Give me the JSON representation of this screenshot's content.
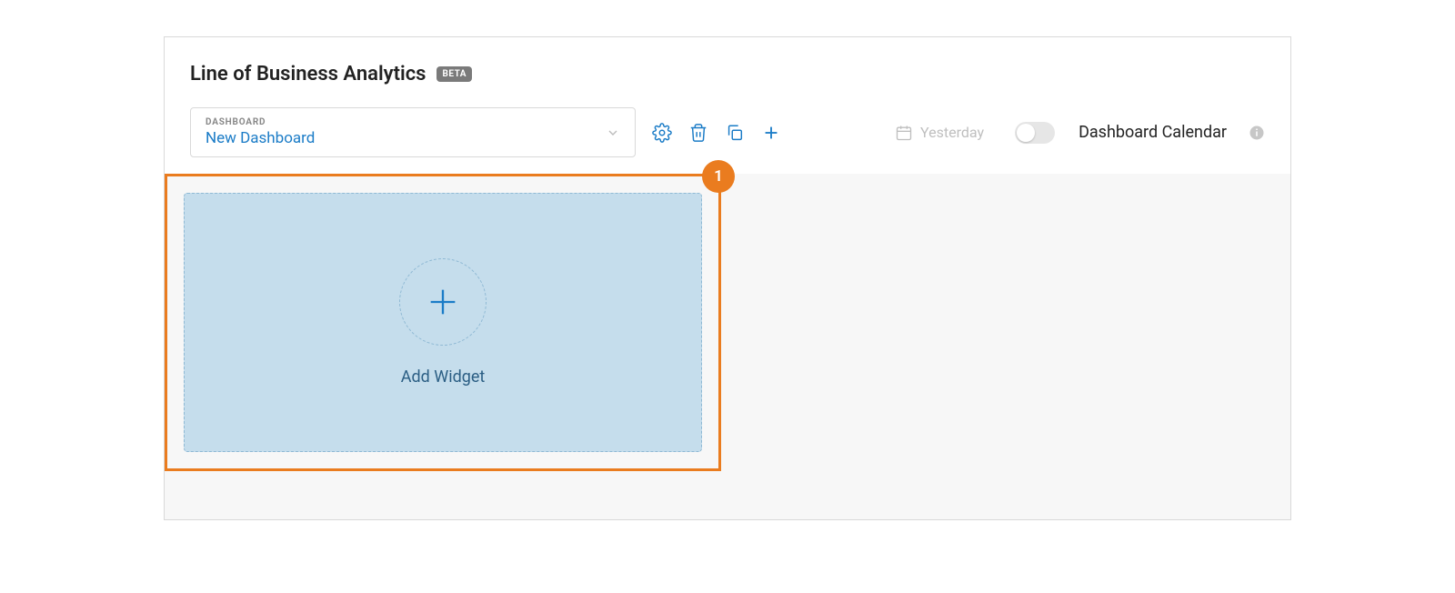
{
  "page": {
    "title": "Line of Business Analytics",
    "beta_badge": "BETA"
  },
  "dashboard_selector": {
    "label": "DASHBOARD",
    "value": "New Dashboard"
  },
  "toolbar_icons": {
    "settings": "gear-icon",
    "delete": "trash-icon",
    "copy": "copy-icon",
    "add": "plus-icon"
  },
  "date": {
    "label": "Yesterday"
  },
  "calendar": {
    "label": "Dashboard Calendar",
    "toggle_on": false
  },
  "callout": {
    "number": "1"
  },
  "widget": {
    "add_label": "Add Widget"
  },
  "colors": {
    "accent_blue": "#1b7cc7",
    "callout_orange": "#ea7c1f",
    "tile_bg": "#c5ddec",
    "muted": "#bfbfbf"
  }
}
